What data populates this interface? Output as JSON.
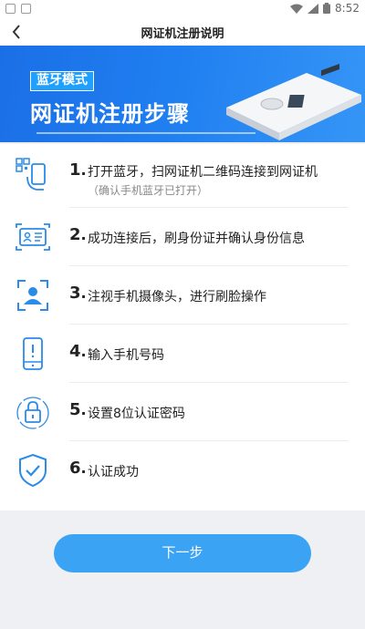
{
  "status_bar": {
    "time": "8:52"
  },
  "header": {
    "title": "网证机注册说明"
  },
  "banner": {
    "badge": "蓝牙模式",
    "title": "网证机注册步骤"
  },
  "steps": [
    {
      "num": "1",
      "text": "打开蓝牙，扫网证机二维码连接到网证机",
      "sub": "（确认手机蓝牙已打开）",
      "icon": "phone-qr-icon"
    },
    {
      "num": "2",
      "text": "成功连接后，刷身份证并确认身份信息",
      "icon": "id-card-icon"
    },
    {
      "num": "3",
      "text": "注视手机摄像头，进行刷脸操作",
      "icon": "face-scan-icon"
    },
    {
      "num": "4",
      "text": "输入手机号码",
      "icon": "mobile-phone-icon"
    },
    {
      "num": "5",
      "text": "设置8位认证密码",
      "icon": "lock-icon"
    },
    {
      "num": "6",
      "text": "认证成功",
      "icon": "shield-check-icon"
    }
  ],
  "next_button": {
    "label": "下一步"
  },
  "colors": {
    "accent": "#3aa3f3",
    "banner": "#1f7ef0",
    "icon": "#2b8be8"
  }
}
